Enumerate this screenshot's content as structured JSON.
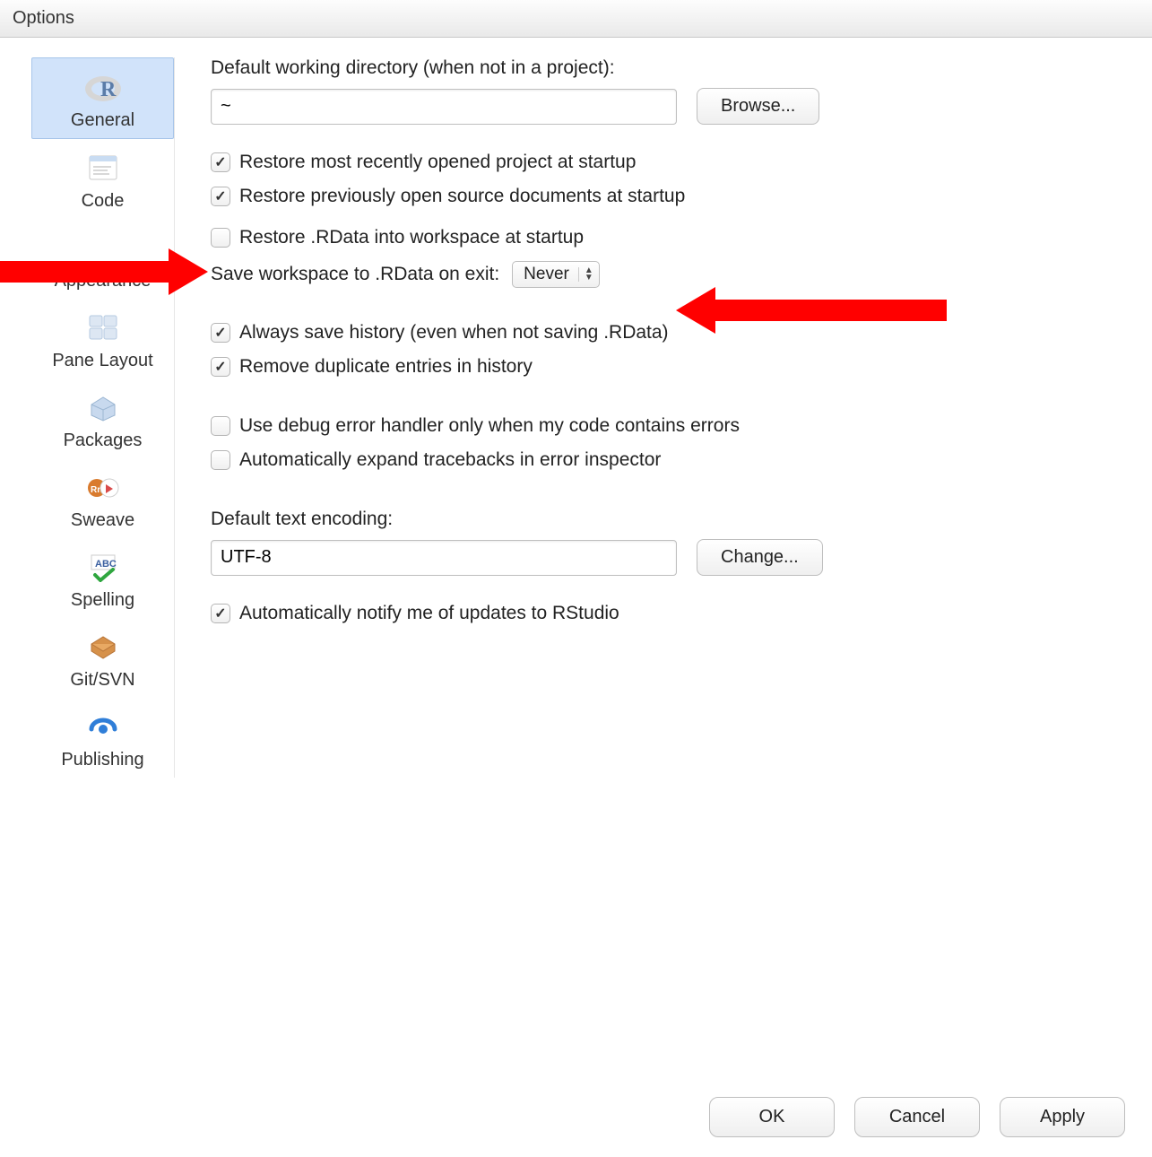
{
  "window": {
    "title": "Options"
  },
  "sidebar": {
    "items": [
      {
        "label": "General"
      },
      {
        "label": "Code"
      },
      {
        "label": "Appearance"
      },
      {
        "label": "Pane Layout"
      },
      {
        "label": "Packages"
      },
      {
        "label": "Sweave"
      },
      {
        "label": "Spelling"
      },
      {
        "label": "Git/SVN"
      },
      {
        "label": "Publishing"
      }
    ]
  },
  "general": {
    "workdir_label": "Default working directory (when not in a project):",
    "workdir_value": "~",
    "browse_button": "Browse...",
    "cb_restore_project": "Restore most recently opened project at startup",
    "cb_restore_docs": "Restore previously open source documents at startup",
    "cb_restore_rdata": "Restore .RData into workspace at startup",
    "save_workspace_label": "Save workspace to .RData on exit:",
    "save_workspace_value": "Never",
    "cb_save_history": "Always save history (even when not saving .RData)",
    "cb_remove_dup_history": "Remove duplicate entries in history",
    "cb_debug_handler": "Use debug error handler only when my code contains errors",
    "cb_expand_traceback": "Automatically expand tracebacks in error inspector",
    "encoding_label": "Default text encoding:",
    "encoding_value": "UTF-8",
    "change_button": "Change...",
    "cb_notify_updates": "Automatically notify me of updates to RStudio"
  },
  "footer": {
    "ok": "OK",
    "cancel": "Cancel",
    "apply": "Apply"
  }
}
